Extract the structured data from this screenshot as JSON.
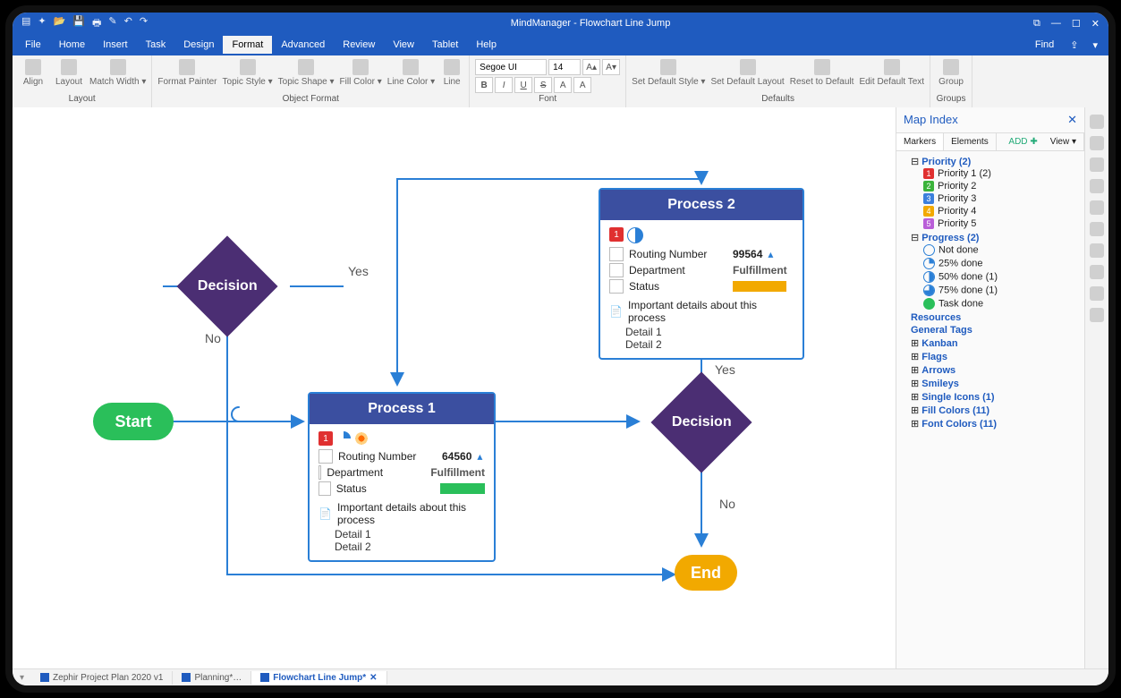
{
  "app": {
    "title": "MindManager - Flowchart Line Jump",
    "find": "Find"
  },
  "menu": [
    "File",
    "Home",
    "Insert",
    "Task",
    "Design",
    "Format",
    "Advanced",
    "Review",
    "View",
    "Tablet",
    "Help"
  ],
  "menu_active": "Format",
  "ribbon": {
    "layout_group": "Layout",
    "layout": [
      "Align",
      "Layout",
      "Match Width ▾"
    ],
    "objfmt_group": "Object Format",
    "objfmt": [
      "Format Painter",
      "Topic Style ▾",
      "Topic Shape ▾",
      "Fill Color ▾",
      "Line Color ▾",
      "Line"
    ],
    "font_group": "Font",
    "font_name": "Segoe UI",
    "font_size": "14",
    "font_plus": "A▴",
    "font_minus": "A▾",
    "bold": "B",
    "italic": "I",
    "underline": "U",
    "strike": "S",
    "fontcolor": "A",
    "clear": "A",
    "defaults_group": "Defaults",
    "defaults": [
      "Set Default Style ▾",
      "Set Default Layout",
      "Reset to Default",
      "Edit Default Text"
    ],
    "groups_group": "Groups",
    "groups": [
      "Group"
    ]
  },
  "flow": {
    "start": "Start",
    "end": "End",
    "decision1": "Decision",
    "decision2": "Decision",
    "yes": "Yes",
    "no": "No",
    "p1": {
      "title": "Process 1",
      "priority": "1",
      "routing_label": "Routing Number",
      "routing_value": "64560",
      "dept_label": "Department",
      "dept_value": "Fulfillment",
      "status_label": "Status",
      "note_title": "Important details about this process",
      "d1": "Detail 1",
      "d2": "Detail 2"
    },
    "p2": {
      "title": "Process 2",
      "priority": "1",
      "routing_label": "Routing Number",
      "routing_value": "99564",
      "dept_label": "Department",
      "dept_value": "Fulfillment",
      "status_label": "Status",
      "note_title": "Important details about this process",
      "d1": "Detail 1",
      "d2": "Detail 2"
    }
  },
  "panel": {
    "title": "Map Index",
    "tab_markers": "Markers",
    "tab_elements": "Elements",
    "add": "ADD",
    "view": "View ▾",
    "priority_hdr": "Priority (2)",
    "priority": [
      {
        "n": "1",
        "label": "Priority 1 (2)"
      },
      {
        "n": "2",
        "label": "Priority 2"
      },
      {
        "n": "3",
        "label": "Priority 3"
      },
      {
        "n": "4",
        "label": "Priority 4"
      },
      {
        "n": "5",
        "label": "Priority 5"
      }
    ],
    "progress_hdr": "Progress (2)",
    "progress": [
      {
        "cls": "",
        "label": "Not done"
      },
      {
        "cls": "q25",
        "label": "25% done"
      },
      {
        "cls": "q50",
        "label": "50% done (1)"
      },
      {
        "cls": "q75",
        "label": "75% done (1)"
      },
      {
        "cls": "pdone",
        "label": "Task done"
      }
    ],
    "resources": "Resources",
    "tags": "General Tags",
    "kanban": "Kanban",
    "flags": "Flags",
    "arrows": "Arrows",
    "smileys": "Smileys",
    "single_icons": "Single Icons (1)",
    "fill_colors": "Fill Colors (11)",
    "font_colors": "Font Colors (11)"
  },
  "doctabs": [
    {
      "label": "Zephir Project Plan 2020 v1",
      "active": false
    },
    {
      "label": "Planning*…",
      "active": false
    },
    {
      "label": "Flowchart Line Jump*",
      "active": true
    }
  ]
}
